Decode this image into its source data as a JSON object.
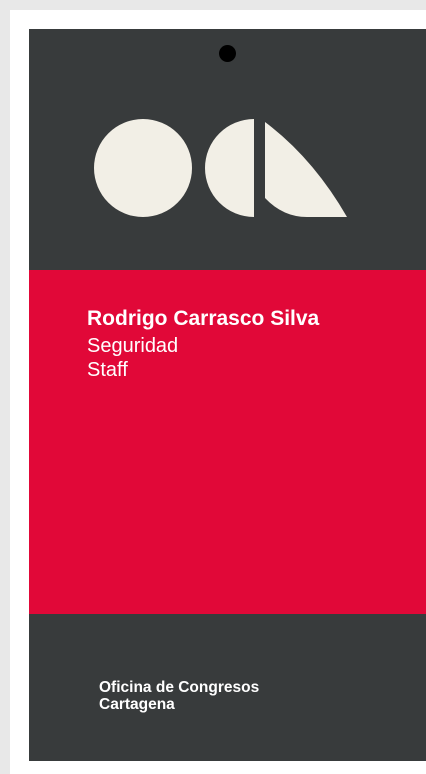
{
  "badge": {
    "name": "Rodrigo Carrasco Silva",
    "department": "Seguridad",
    "category": "Staff",
    "organization": {
      "line1": "Oficina de Congresos",
      "line2": "Cartagena"
    },
    "logo_icon": "occ-logo-icon",
    "colors": {
      "dark": "#383b3c",
      "accent": "#e10838",
      "logo": "#f2efe6"
    }
  }
}
